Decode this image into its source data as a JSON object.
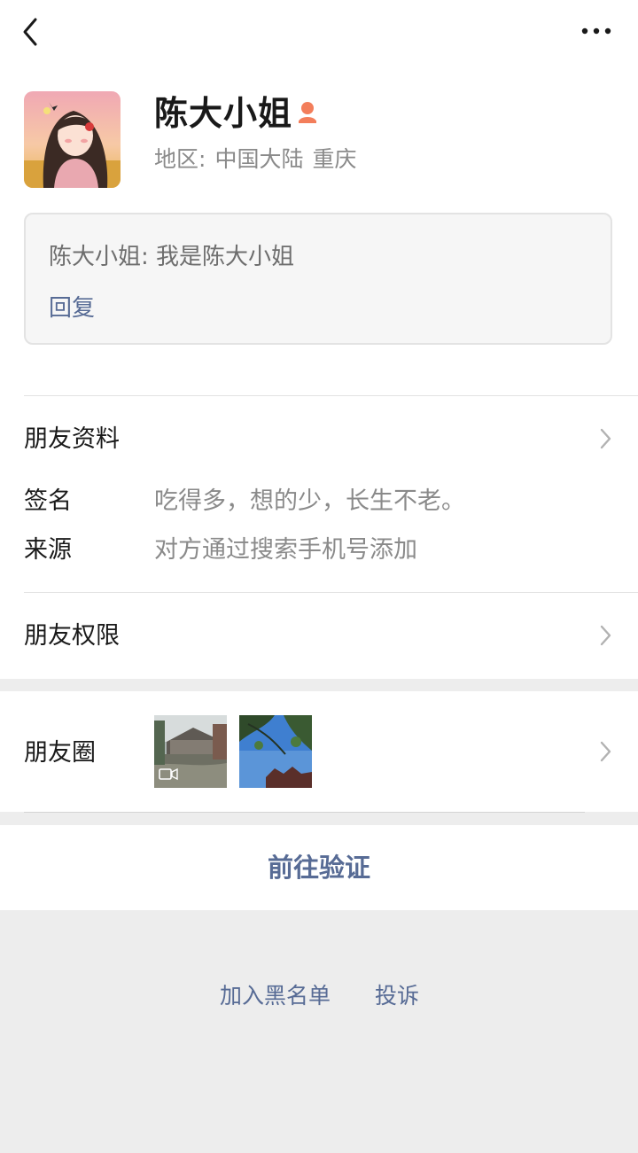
{
  "nav": {
    "back_icon": "chevron-left-icon",
    "more_icon": "more-dots-icon"
  },
  "profile": {
    "name": "陈大小姐",
    "gender_icon": "female-icon",
    "gender_color": "#f37e5b",
    "region_label": "地区:",
    "region_country": "中国大陆",
    "region_city": "重庆"
  },
  "message": {
    "text": "陈大小姐: 我是陈大小姐",
    "reply_label": "回复"
  },
  "friend_info": {
    "title": "朋友资料",
    "signature_label": "签名",
    "signature_value": "吃得多，想的少，长生不老。",
    "source_label": "来源",
    "source_value": "对方通过搜索手机号添加"
  },
  "permissions": {
    "title": "朋友权限"
  },
  "moments": {
    "title": "朋友圈",
    "first_thumb_icon": "video-icon"
  },
  "actions": {
    "verify": "前往验证",
    "blacklist": "加入黑名单",
    "report": "投诉"
  },
  "colors": {
    "link": "#576b95",
    "secondary_text": "#8a8a8a",
    "background": "#ededed"
  }
}
